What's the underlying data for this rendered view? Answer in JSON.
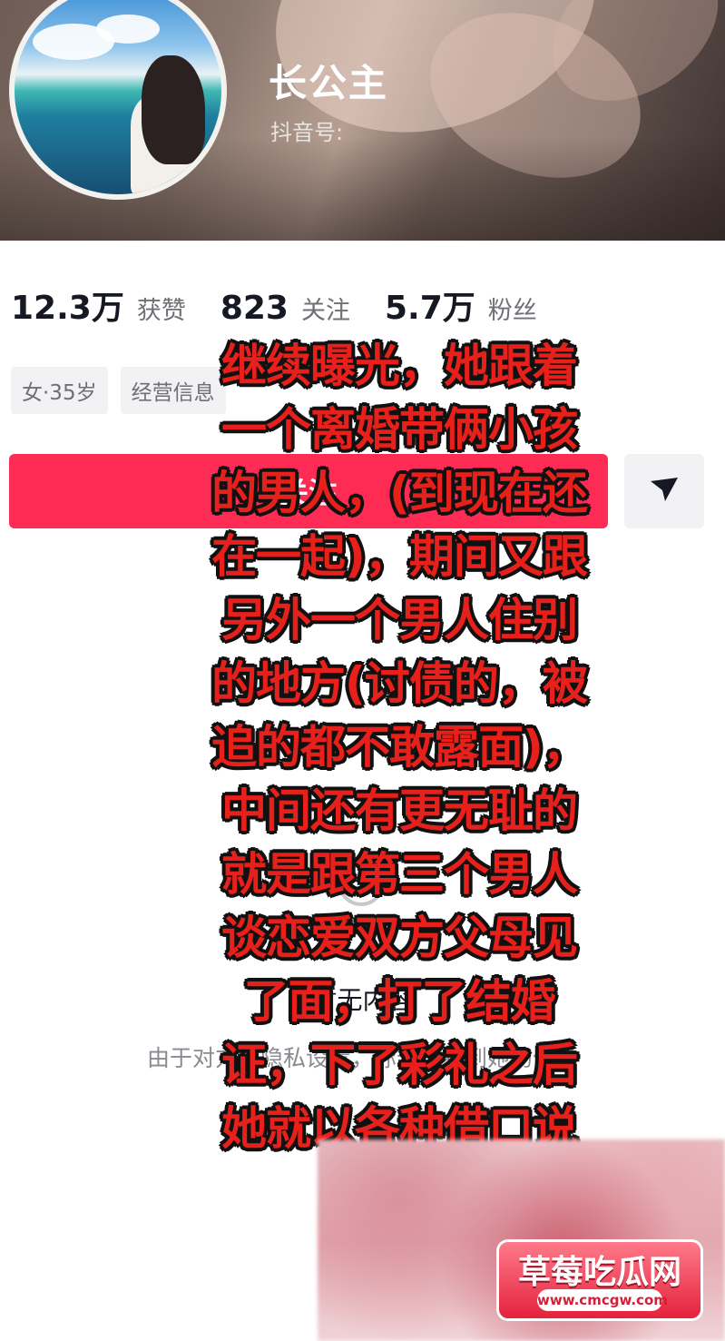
{
  "profile": {
    "name": "长公主",
    "douyin_id_label": "抖音号:"
  },
  "stats": [
    {
      "value": "12.3万",
      "label": "获赞"
    },
    {
      "value": "823",
      "label": "关注"
    },
    {
      "value": "5.7万",
      "label": "粉丝"
    }
  ],
  "tags": [
    "女·35岁",
    "经营信息"
  ],
  "actions": {
    "follow_label": "关注",
    "more_icon": "triangle-down-icon"
  },
  "empty_state": {
    "title": "暂无内容",
    "subtitle": "由于对方的隐私设置，你无法看到她的作品"
  },
  "overlay": {
    "caption": "继续曝光，她跟着\n一个离婚带俩小孩\n的男人，(到现在还\n在一起)，期间又跟\n另外一个男人住别\n的地方(讨债的，被\n追的都不敢露面)，\n中间还有更无耻的\n就是跟第三个男人\n谈恋爱双方父母见\n了面，打了结婚\n证，下了彩礼之后\n她就以各种借口说\n不合适\n(这事"
  },
  "watermark": {
    "title": "草莓吃瓜网",
    "url": "www.cmcgw.com"
  },
  "colors": {
    "follow": "#fe2c55",
    "caption_text": "#e8201b",
    "caption_outline": "#111111"
  }
}
